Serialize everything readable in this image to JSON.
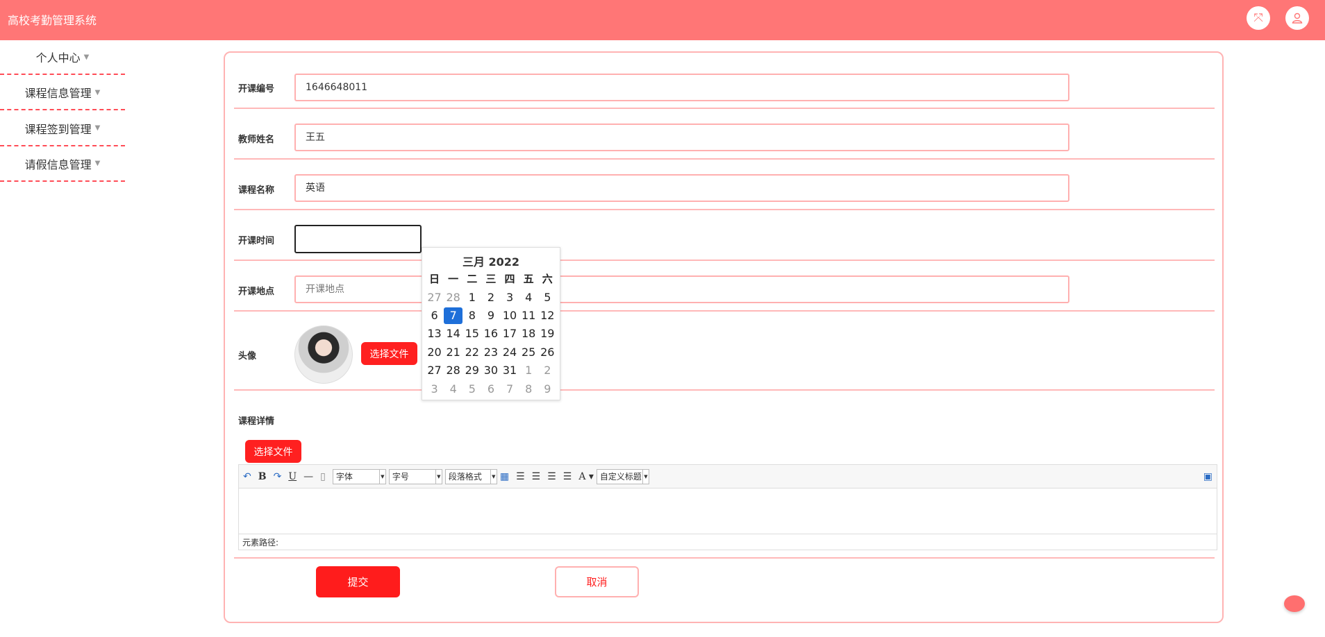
{
  "header": {
    "title": "高校考勤管理系统",
    "fullscreen_icon": "fullscreen-icon",
    "user_icon": "user-icon"
  },
  "sidebar": {
    "items": [
      {
        "label": "个人中心"
      },
      {
        "label": "课程信息管理"
      },
      {
        "label": "课程签到管理"
      },
      {
        "label": "请假信息管理"
      }
    ]
  },
  "form": {
    "course_code": {
      "label": "开课编号",
      "value": "1646648011"
    },
    "teacher_name": {
      "label": "教师姓名",
      "value": "王五"
    },
    "course_name": {
      "label": "课程名称",
      "value": "英语"
    },
    "start_time": {
      "label": "开课时间",
      "value": ""
    },
    "location": {
      "label": "开课地点",
      "placeholder": "开课地点"
    },
    "avatar": {
      "label": "头像",
      "button": "选择文件"
    },
    "details": {
      "label": "课程详情",
      "button": "选择文件"
    }
  },
  "editor": {
    "font_select": "字体",
    "size_select": "字号",
    "para_select": "段落格式",
    "custom_title_select": "自定义标题",
    "path_label": "元素路径:"
  },
  "actions": {
    "submit": "提交",
    "cancel": "取消"
  },
  "calendar": {
    "title": "三月 2022",
    "weekdays": [
      "日",
      "一",
      "二",
      "三",
      "四",
      "五",
      "六"
    ],
    "weeks": [
      [
        "27",
        "28",
        "1",
        "2",
        "3",
        "4",
        "5"
      ],
      [
        "6",
        "7",
        "8",
        "9",
        "10",
        "11",
        "12"
      ],
      [
        "13",
        "14",
        "15",
        "16",
        "17",
        "18",
        "19"
      ],
      [
        "20",
        "21",
        "22",
        "23",
        "24",
        "25",
        "26"
      ],
      [
        "27",
        "28",
        "29",
        "30",
        "31",
        "1",
        "2"
      ],
      [
        "3",
        "4",
        "5",
        "6",
        "7",
        "8",
        "9"
      ]
    ],
    "selected_day": "7"
  }
}
